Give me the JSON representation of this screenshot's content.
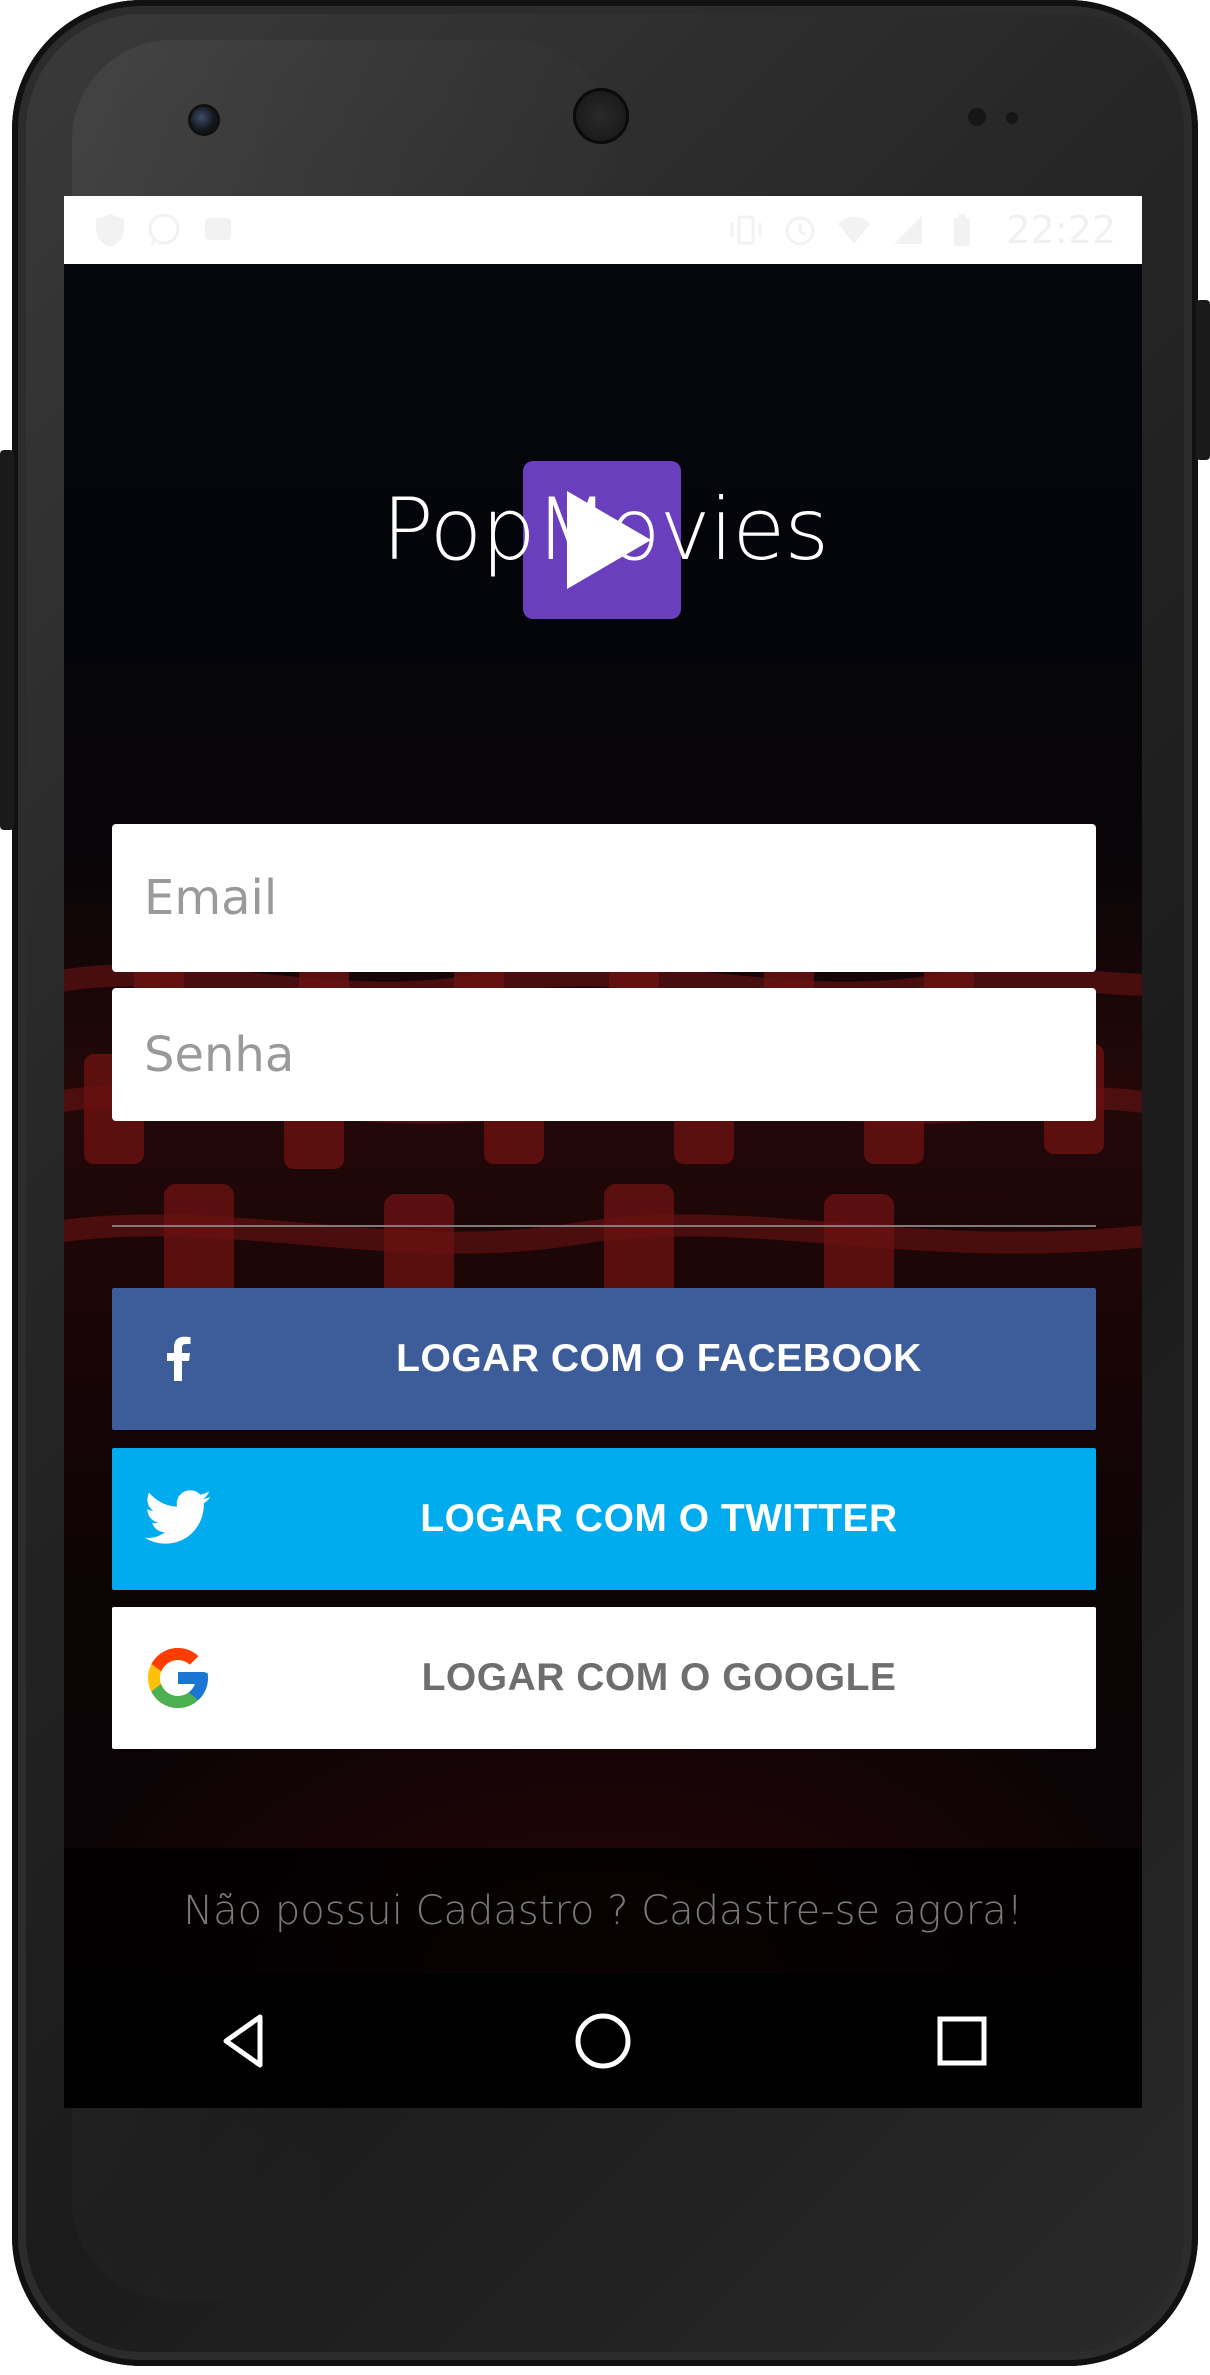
{
  "status_bar": {
    "time": "22:22",
    "left_icons": [
      "shield-icon",
      "whatsapp-icon",
      "message-icon"
    ],
    "right_icons": [
      "vibrate-icon",
      "alarm-icon",
      "wifi-icon",
      "signal-icon",
      "battery-icon"
    ]
  },
  "app": {
    "title": "PopMovies",
    "logo_color": "#6a3fbd"
  },
  "login_form": {
    "email_placeholder": "Email",
    "password_placeholder": "Senha"
  },
  "social_buttons": {
    "facebook_label": "LOGAR COM O FACEBOOK",
    "twitter_label": "LOGAR COM O TWITTER",
    "google_label": "LOGAR COM O GOOGLE",
    "facebook_color": "#3d5c9a",
    "twitter_color": "#00aced",
    "google_color": "#ffffff"
  },
  "signup": {
    "text": "Não possui Cadastro ? Cadastre-se agora!"
  },
  "navigation": {
    "back_icon": "back-triangle-icon",
    "home_icon": "home-circle-icon",
    "recents_icon": "recents-square-icon"
  }
}
